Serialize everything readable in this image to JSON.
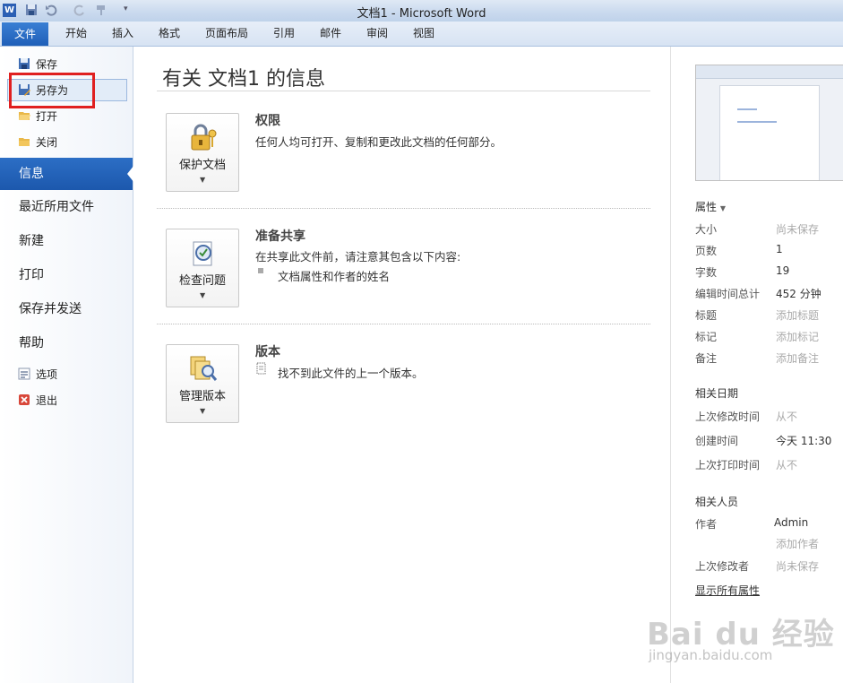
{
  "window": {
    "title": "文档1  -  Microsoft Word"
  },
  "ribbon": {
    "file_tab": "文件",
    "tabs": [
      "开始",
      "插入",
      "格式",
      "页面布局",
      "引用",
      "邮件",
      "审阅",
      "视图"
    ]
  },
  "leftnav": {
    "top_items": [
      {
        "label": "保存",
        "icon": "save-icon"
      },
      {
        "label": "另存为",
        "icon": "save-as-icon"
      },
      {
        "label": "打开",
        "icon": "open-folder-icon"
      },
      {
        "label": "关闭",
        "icon": "close-folder-icon"
      }
    ],
    "main_items": [
      "信息",
      "最近所用文件",
      "新建",
      "打印",
      "保存并发送",
      "帮助"
    ],
    "bottom_items": [
      {
        "label": "选项",
        "icon": "options-icon"
      },
      {
        "label": "退出",
        "icon": "exit-icon"
      }
    ],
    "selected": "信息"
  },
  "main": {
    "title": "有关 文档1 的信息",
    "sections": [
      {
        "button": "保护文档",
        "heading": "权限",
        "text": "任何人均可打开、复制和更改此文档的任何部分。"
      },
      {
        "button": "检查问题",
        "heading": "准备共享",
        "text": "在共享此文件前，请注意其包含以下内容:",
        "bullet": "文档属性和作者的姓名"
      },
      {
        "button": "管理版本",
        "heading": "版本",
        "text": "找不到此文件的上一个版本。"
      }
    ]
  },
  "properties": {
    "header": "属性",
    "rows": [
      {
        "k": "大小",
        "v": "尚未保存",
        "placeholder": true
      },
      {
        "k": "页数",
        "v": "1",
        "placeholder": false
      },
      {
        "k": "字数",
        "v": "19",
        "placeholder": false
      },
      {
        "k": "编辑时间总计",
        "v": "452 分钟",
        "placeholder": false
      },
      {
        "k": "标题",
        "v": "添加标题",
        "placeholder": true
      },
      {
        "k": "标记",
        "v": "添加标记",
        "placeholder": true
      },
      {
        "k": "备注",
        "v": "添加备注",
        "placeholder": true
      }
    ],
    "dates_header": "相关日期",
    "dates": [
      {
        "k": "上次修改时间",
        "v": "从不",
        "placeholder": true
      },
      {
        "k": "创建时间",
        "v": "今天 11:30",
        "placeholder": false
      },
      {
        "k": "上次打印时间",
        "v": "从不",
        "placeholder": true
      }
    ],
    "people_header": "相关人员",
    "author_label": "作者",
    "author_value": "Admin",
    "add_author": "添加作者",
    "last_modified_by_label": "上次修改者",
    "last_modified_by_value": "尚未保存",
    "show_all": "显示所有属性"
  },
  "watermark": {
    "line1": "Bai du 经验",
    "line2": "jingyan.baidu.com"
  },
  "colors": {
    "accent": "#1f5fb8",
    "highlight": "#e02020"
  }
}
